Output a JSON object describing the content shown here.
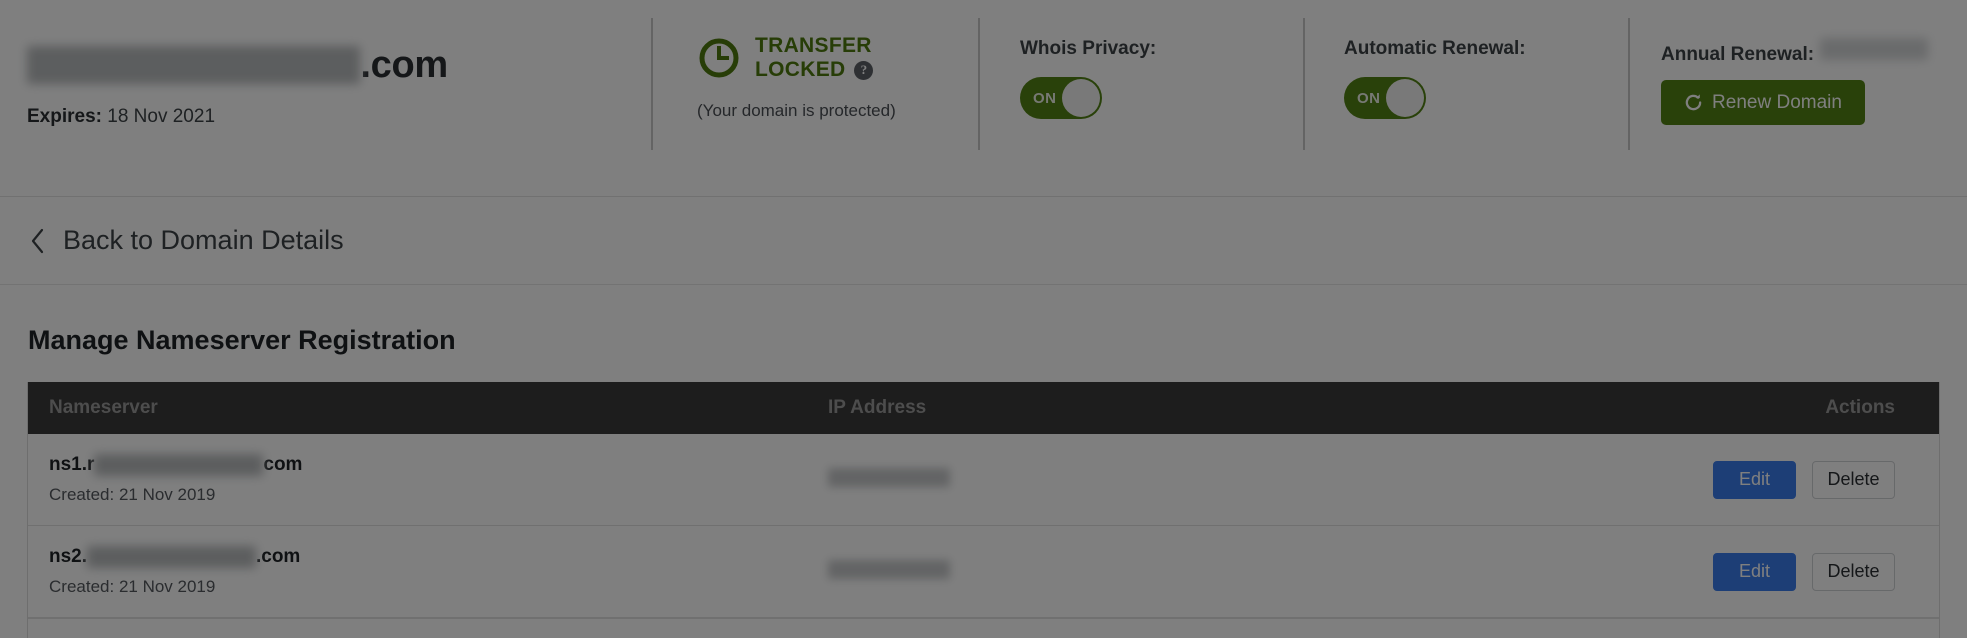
{
  "domain_bar": {
    "domain_prefix_redacted": "makebrandfamous",
    "domain_suffix": ".com",
    "expires_label": "Expires:",
    "expires_value": "18 Nov 2021",
    "transfer_status_line1": "TRANSFER",
    "transfer_status_line2": "LOCKED",
    "help_glyph": "?",
    "transfer_sub": "(Your domain is protected)",
    "whois_label": "Whois Privacy:",
    "whois_toggle_state": "ON",
    "auto_renewal_label": "Automatic Renewal:",
    "auto_renewal_toggle_state": "ON",
    "annual_renewal_label": "Annual Renewal:",
    "annual_renewal_price_redacted": "",
    "renew_button_label": "Renew Domain",
    "icons": {
      "clock": "clock-icon",
      "help": "help-circle-icon",
      "refresh": "refresh-icon"
    },
    "colors": {
      "green": "#538314",
      "green_text": "#4e7a0e",
      "blue": "#3b7ded"
    }
  },
  "back_link": {
    "label": "Back to Domain Details",
    "icon": "chevron-left-icon"
  },
  "main": {
    "page_title": "Manage Nameserver Registration"
  },
  "table": {
    "headers": {
      "nameserver": "Nameserver",
      "ip_address": "IP Address",
      "actions": "Actions"
    },
    "rows": [
      {
        "nameserver_prefix": "ns1.r",
        "nameserver_redacted": "makebrandfamous",
        "nameserver_suffix": "com",
        "created_label": "Created:",
        "created_value": "21 Nov 2019",
        "ip_redacted": "",
        "edit_label": "Edit",
        "delete_label": "Delete"
      },
      {
        "nameserver_prefix": "ns2.",
        "nameserver_redacted": "makebrandfamous",
        "nameserver_suffix": ".com",
        "created_label": "Created:",
        "created_value": "21 Nov 2019",
        "ip_redacted": "",
        "edit_label": "Edit",
        "delete_label": "Delete"
      }
    ]
  }
}
